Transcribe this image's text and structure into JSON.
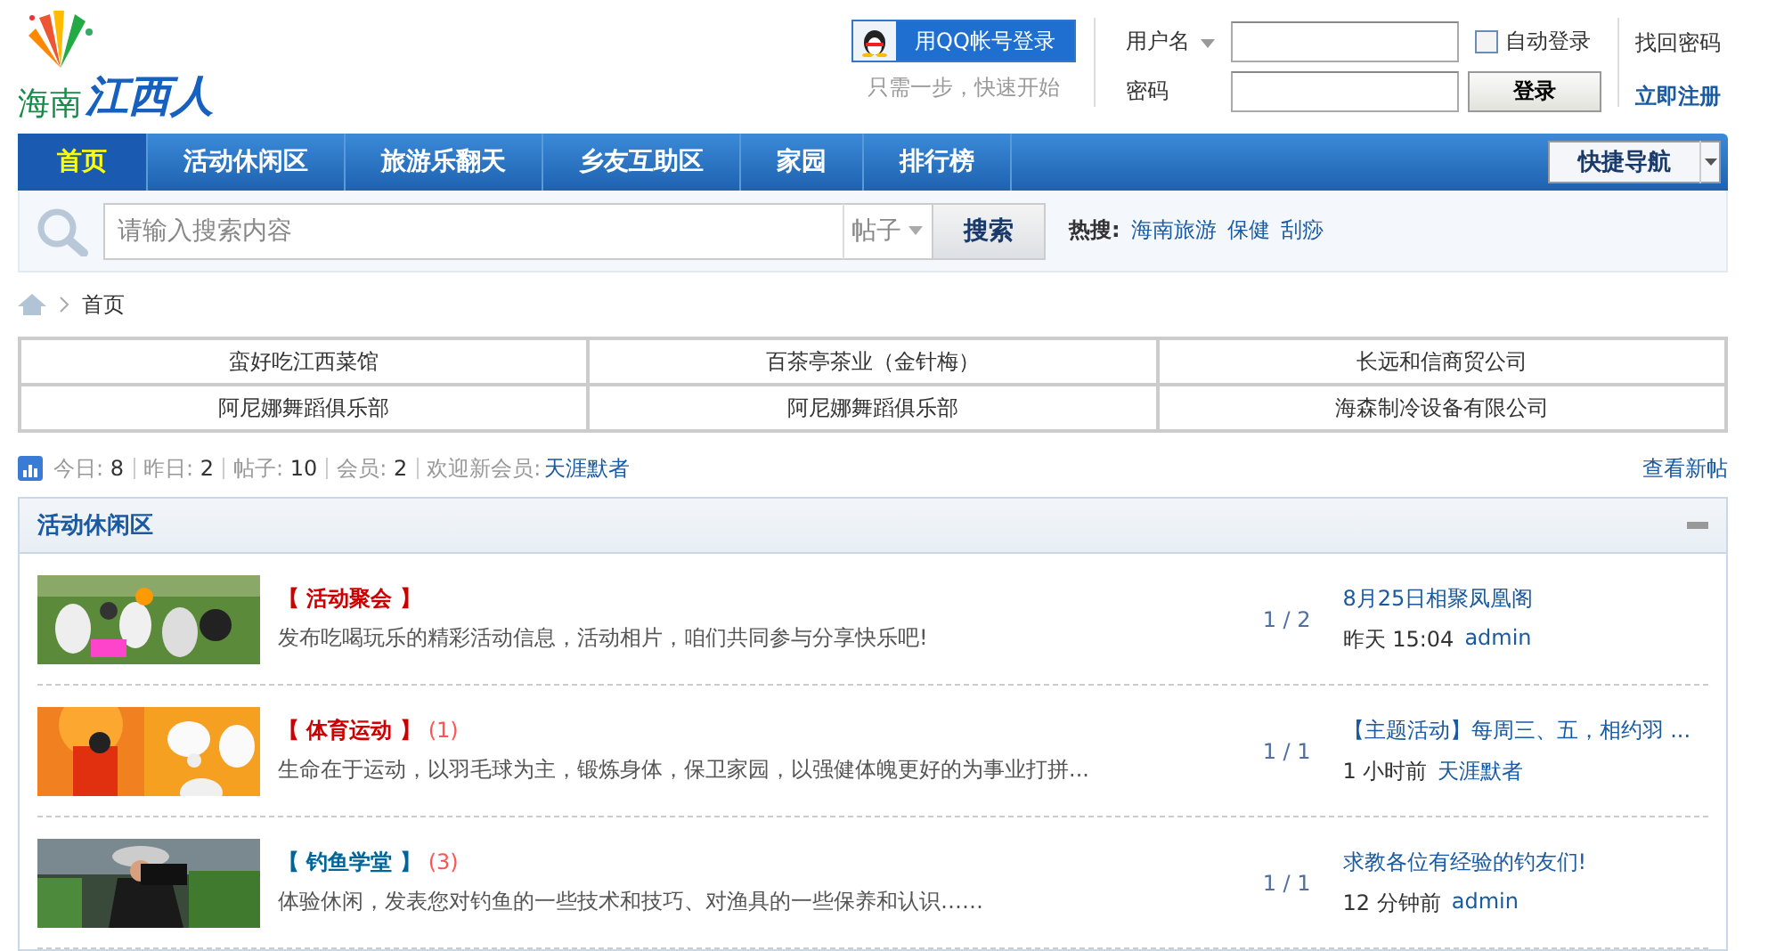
{
  "logo": {
    "region": "海南",
    "name": "江西人"
  },
  "qq_login": {
    "button": "用QQ帐号登录",
    "hint": "只需一步，快速开始"
  },
  "login": {
    "username_label": "用户名",
    "password_label": "密码",
    "auto_login": {
      "label": "自动登录",
      "checked": false
    },
    "submit": "登录",
    "links": [
      "找回密码",
      "立即注册"
    ]
  },
  "nav": {
    "items": [
      {
        "label": "首页",
        "selected": true
      },
      {
        "label": "活动休闲区",
        "selected": false
      },
      {
        "label": "旅游乐翻天",
        "selected": false
      },
      {
        "label": "乡友互助区",
        "selected": false
      },
      {
        "label": "家园",
        "selected": false
      },
      {
        "label": "排行榜",
        "selected": false
      }
    ],
    "quick_nav": "快捷导航"
  },
  "search": {
    "placeholder": "请输入搜索内容",
    "type": "帖子",
    "button": "搜索",
    "hot_label": "热搜:",
    "hot": [
      "海南旅游",
      "保健",
      "刮痧"
    ]
  },
  "breadcrumb": [
    "首页"
  ],
  "links": [
    [
      "蛮好吃江西菜馆",
      "百茶亭茶业（金针梅）",
      "长远和信商贸公司"
    ],
    [
      "阿尼娜舞蹈俱乐部",
      "阿尼娜舞蹈俱乐部",
      "海森制冷设备有限公司"
    ]
  ],
  "stats": {
    "items": [
      {
        "label": "今日:",
        "value": "8"
      },
      {
        "label": "昨日:",
        "value": "2"
      },
      {
        "label": "帖子:",
        "value": "10"
      },
      {
        "label": "会员:",
        "value": "2"
      }
    ],
    "welcome_label": "欢迎新会员:",
    "new_member": "天涯默者",
    "new_posts": "查看新帖"
  },
  "section": {
    "title": "活动休闲区",
    "forums": [
      {
        "name": "【 活动聚会 】",
        "color": "#cc0000",
        "description": "发布吃喝玩乐的精彩活动信息，活动相片，咱们共同参与分享快乐吧!",
        "counts": "1 / 2",
        "last_title": "8月25日相聚凤凰阁",
        "last_time": "昨天 15:04",
        "last_author": "admin"
      },
      {
        "name": "【 体育运动 】",
        "color": "#cc0000",
        "new": "(1)",
        "description": "生命在于运动，以羽毛球为主，锻炼身体，保卫家园，以强健体魄更好的为事业打拼...",
        "counts": "1 / 1",
        "last_title": "【主题活动】每周三、五，相约羽 ...",
        "last_time": "1 小时前",
        "last_author": "天涯默者"
      },
      {
        "name": "【 钓鱼学堂 】",
        "color": "#006699",
        "new": "(3)",
        "description": "体验休闲，发表您对钓鱼的一些技术和技巧、对渔具的一些保养和认识……",
        "counts": "1 / 1",
        "last_title": "求教各位有经验的钓友们!",
        "last_time": "12 分钟前",
        "last_author": "admin"
      }
    ]
  }
}
